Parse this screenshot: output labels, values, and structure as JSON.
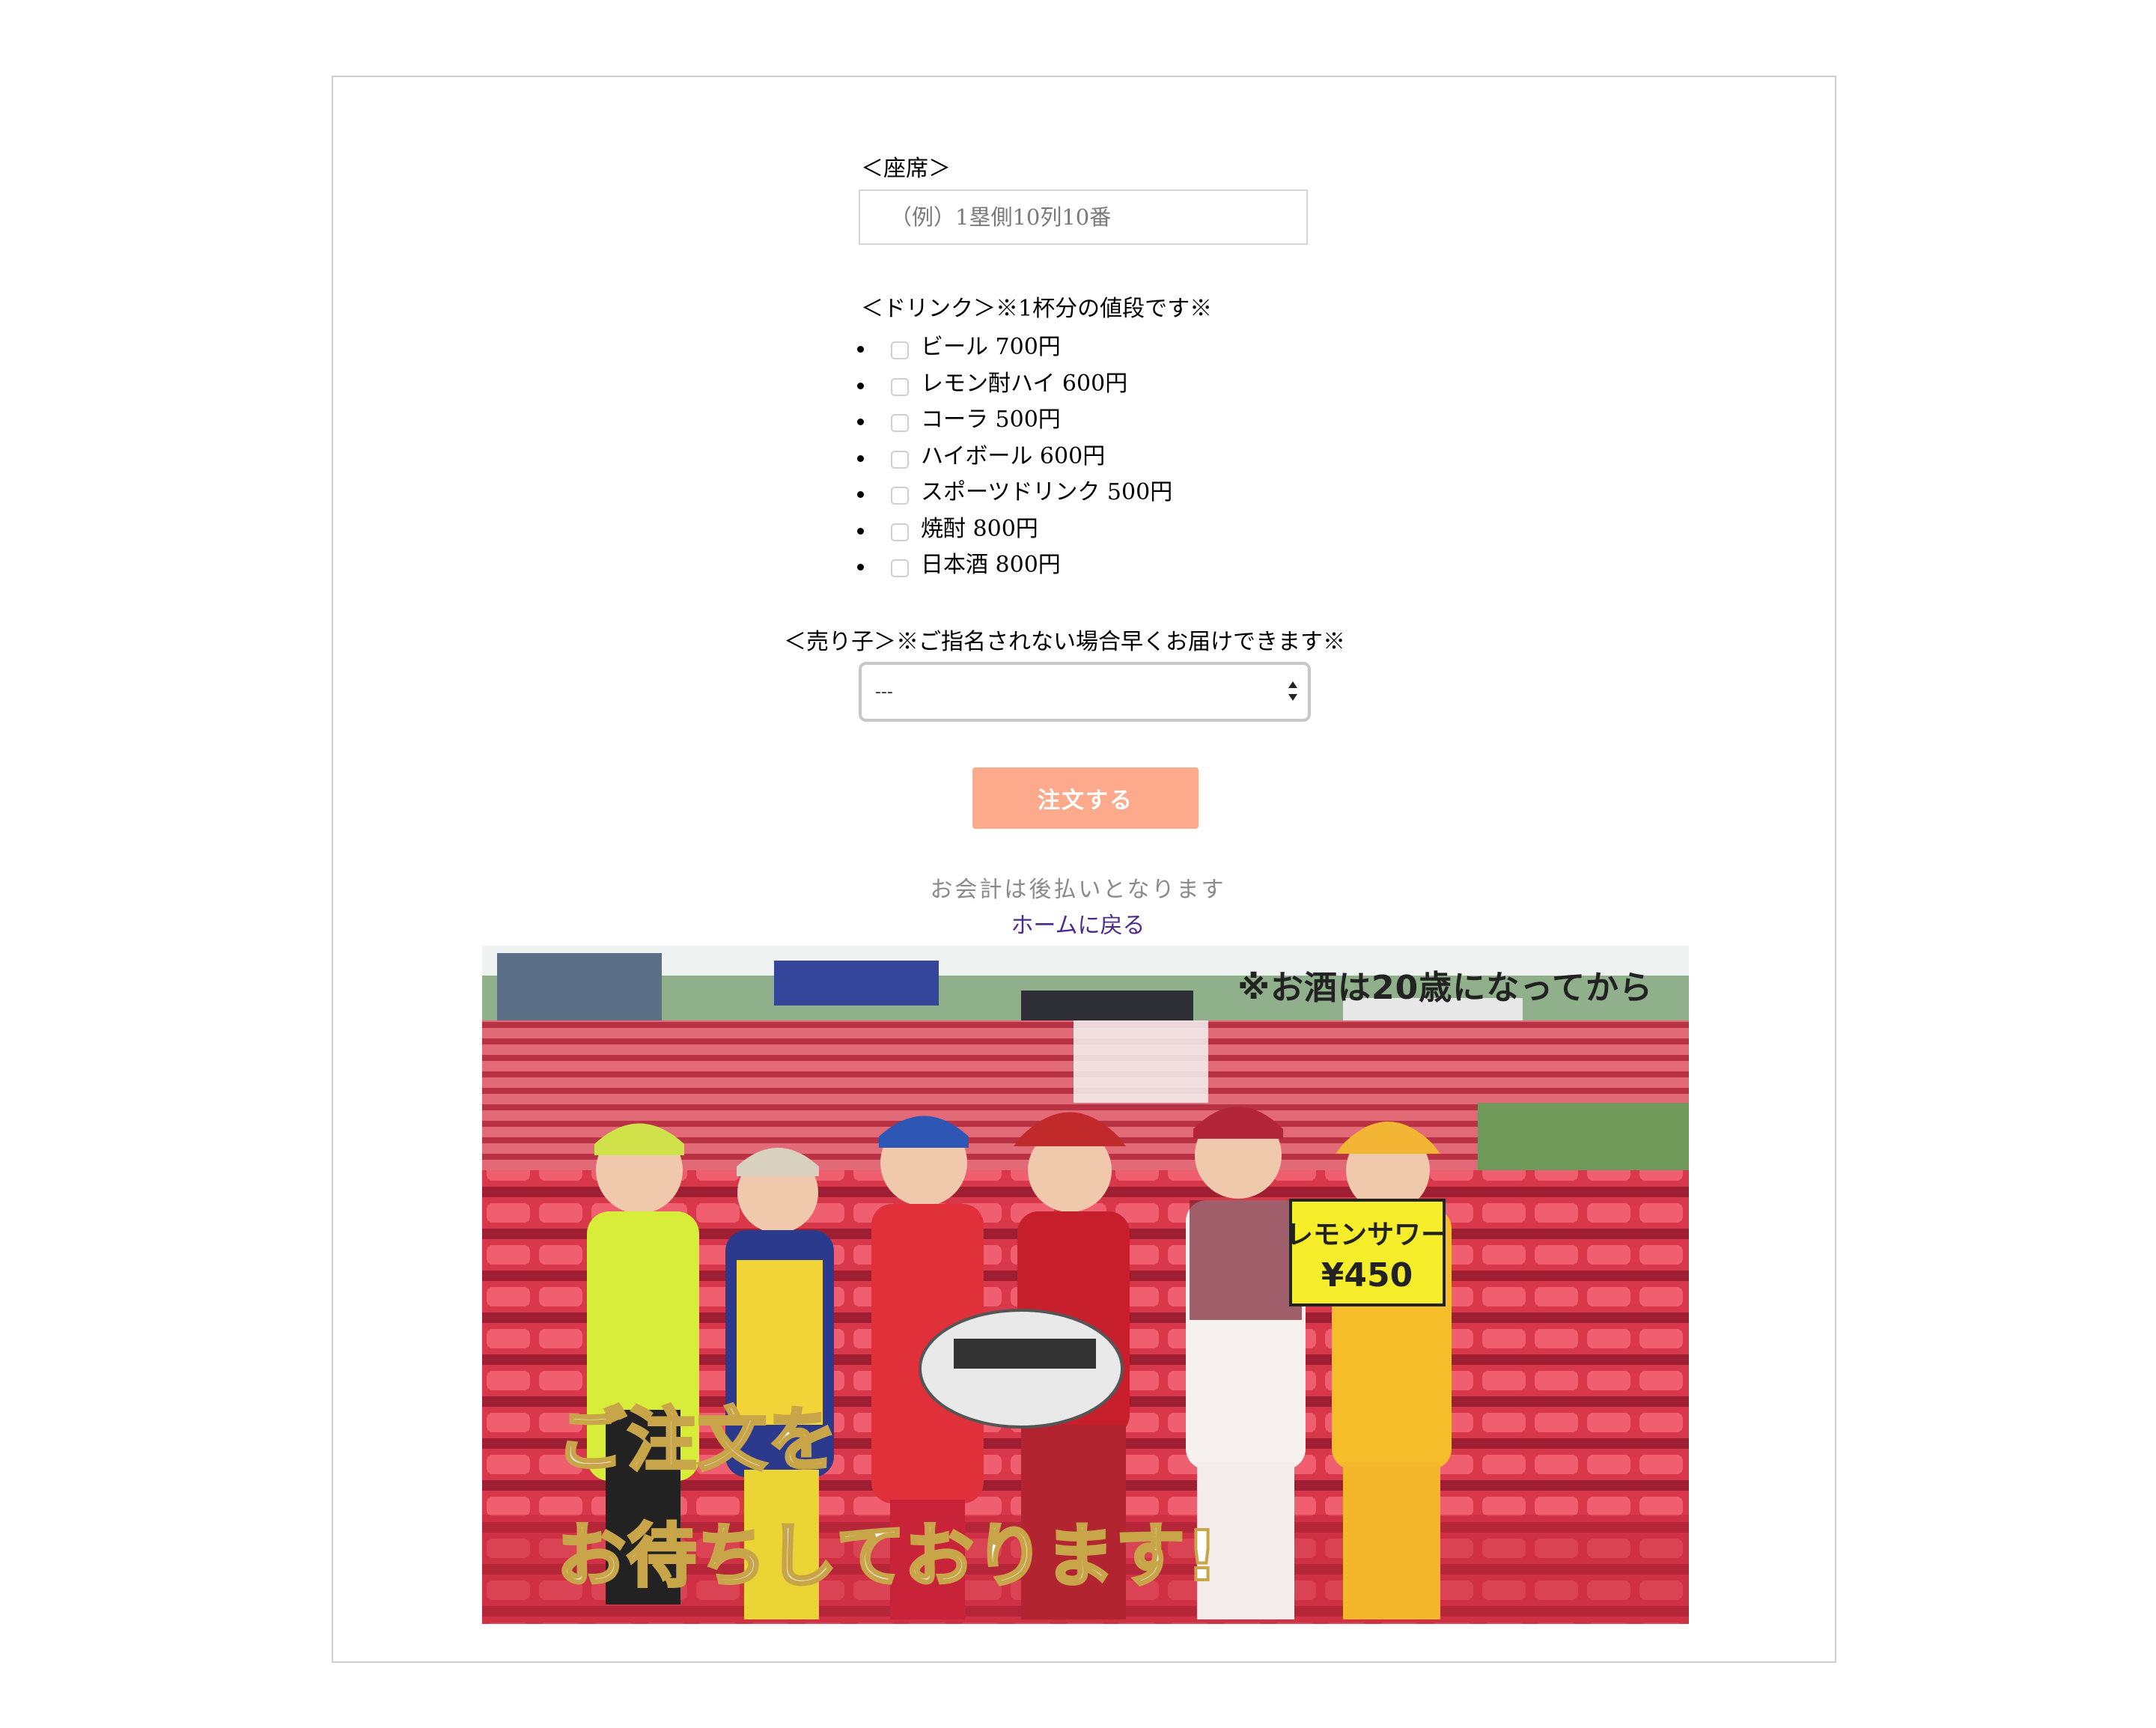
{
  "seat": {
    "label": "＜座席＞",
    "placeholder": "（例）1塁側10列10番"
  },
  "drink": {
    "label": "＜ドリンク＞※1杯分の値段です※",
    "items": [
      {
        "label": "ビール 700円"
      },
      {
        "label": "レモン酎ハイ 600円"
      },
      {
        "label": "コーラ 500円"
      },
      {
        "label": "ハイボール 600円"
      },
      {
        "label": "スポーツドリンク 500円"
      },
      {
        "label": "焼酎 800円"
      },
      {
        "label": "日本酒 800円"
      }
    ]
  },
  "vendor": {
    "label": "＜売り子＞※ご指名されない場合早くお届けできます※",
    "selected": "---"
  },
  "order_button": "注文する",
  "payment_note": "お会計は後払いとなります",
  "home_link": "ホームに戻る",
  "banner": {
    "top_caption": "※お酒は20歳になってから",
    "line1": "ご注文を",
    "line2": "お待ちしております!",
    "sign_line1": "レモンサワー",
    "sign_line2": "¥450"
  },
  "colors": {
    "button": "#fca98c",
    "link": "#4a2a8a",
    "stands": "#c7303f"
  }
}
